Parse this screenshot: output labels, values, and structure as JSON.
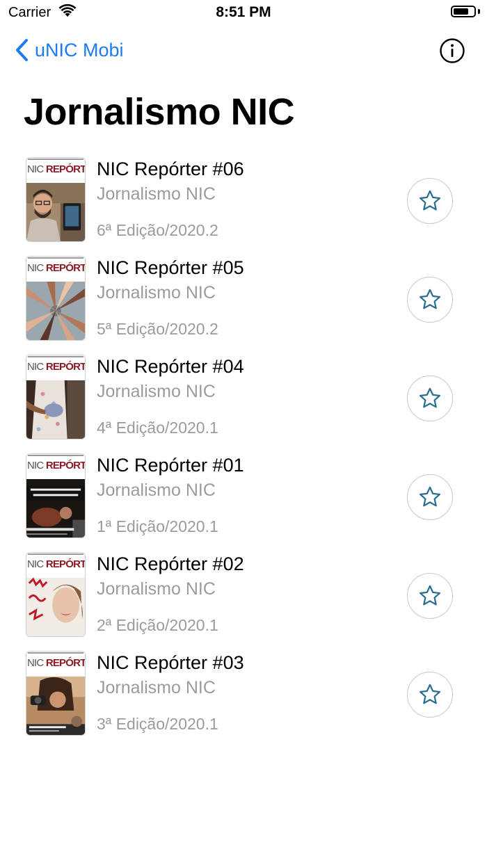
{
  "status_bar": {
    "carrier": "Carrier",
    "time": "8:51 PM",
    "battery_level": 0.75
  },
  "nav": {
    "back_label": "uNIC Mobi",
    "info_icon": "info-circle-icon"
  },
  "page": {
    "title": "Jornalismo NIC"
  },
  "items": [
    {
      "title": "NIC Repórter #06",
      "subtitle": "Jornalismo NIC",
      "edition": "6ª Edição/2020.2",
      "favorite_icon": "star-outline-icon"
    },
    {
      "title": "NIC Repórter #05",
      "subtitle": "Jornalismo NIC",
      "edition": "5ª Edição/2020.2",
      "favorite_icon": "star-outline-icon"
    },
    {
      "title": "NIC Repórter #04",
      "subtitle": "Jornalismo NIC",
      "edition": "4ª Edição/2020.1",
      "favorite_icon": "star-outline-icon"
    },
    {
      "title": "NIC Repórter #01",
      "subtitle": "Jornalismo NIC",
      "edition": "1ª Edição/2020.1",
      "favorite_icon": "star-outline-icon"
    },
    {
      "title": "NIC Repórter #02",
      "subtitle": "Jornalismo NIC",
      "edition": "2ª Edição/2020.1",
      "favorite_icon": "star-outline-icon"
    },
    {
      "title": "NIC Repórter #03",
      "subtitle": "Jornalismo NIC",
      "edition": "3ª Edição/2020.1",
      "favorite_icon": "star-outline-icon"
    }
  ],
  "colors": {
    "accent": "#1a7cf0",
    "star": "#2a6f8f",
    "secondary_text": "#9b9b9b",
    "masthead": "#8b1a24"
  },
  "cover_logo": {
    "prefix": "NIC",
    "name": "REPÓRTER"
  }
}
